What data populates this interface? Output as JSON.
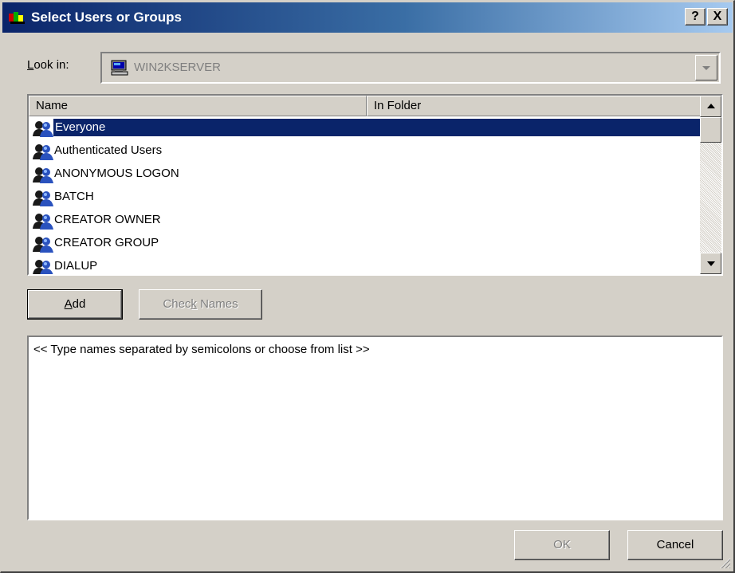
{
  "window": {
    "title": "Select Users or Groups",
    "help_label": "?",
    "close_label": "X"
  },
  "look_in": {
    "label_accel": "L",
    "label_rest": "ook in:",
    "value": "WIN2KSERVER"
  },
  "list": {
    "columns": [
      "Name",
      "In Folder"
    ],
    "items": [
      {
        "name": "Everyone",
        "selected": true
      },
      {
        "name": "Authenticated Users"
      },
      {
        "name": "ANONYMOUS LOGON"
      },
      {
        "name": "BATCH"
      },
      {
        "name": "CREATOR OWNER"
      },
      {
        "name": "CREATOR GROUP"
      },
      {
        "name": "DIALUP"
      }
    ]
  },
  "buttons": {
    "add_accel": "A",
    "add_rest": "dd",
    "check_pre": "Chec",
    "check_accel": "k",
    "check_rest": " Names",
    "ok": "OK",
    "cancel": "Cancel"
  },
  "names_box": {
    "text": "<< Type names separated by semicolons or choose from list >>"
  },
  "colors": {
    "selection": "#0a246a",
    "title_gradient_start": "#0a246a",
    "title_gradient_end": "#a6caf0",
    "face": "#d4d0c8"
  }
}
